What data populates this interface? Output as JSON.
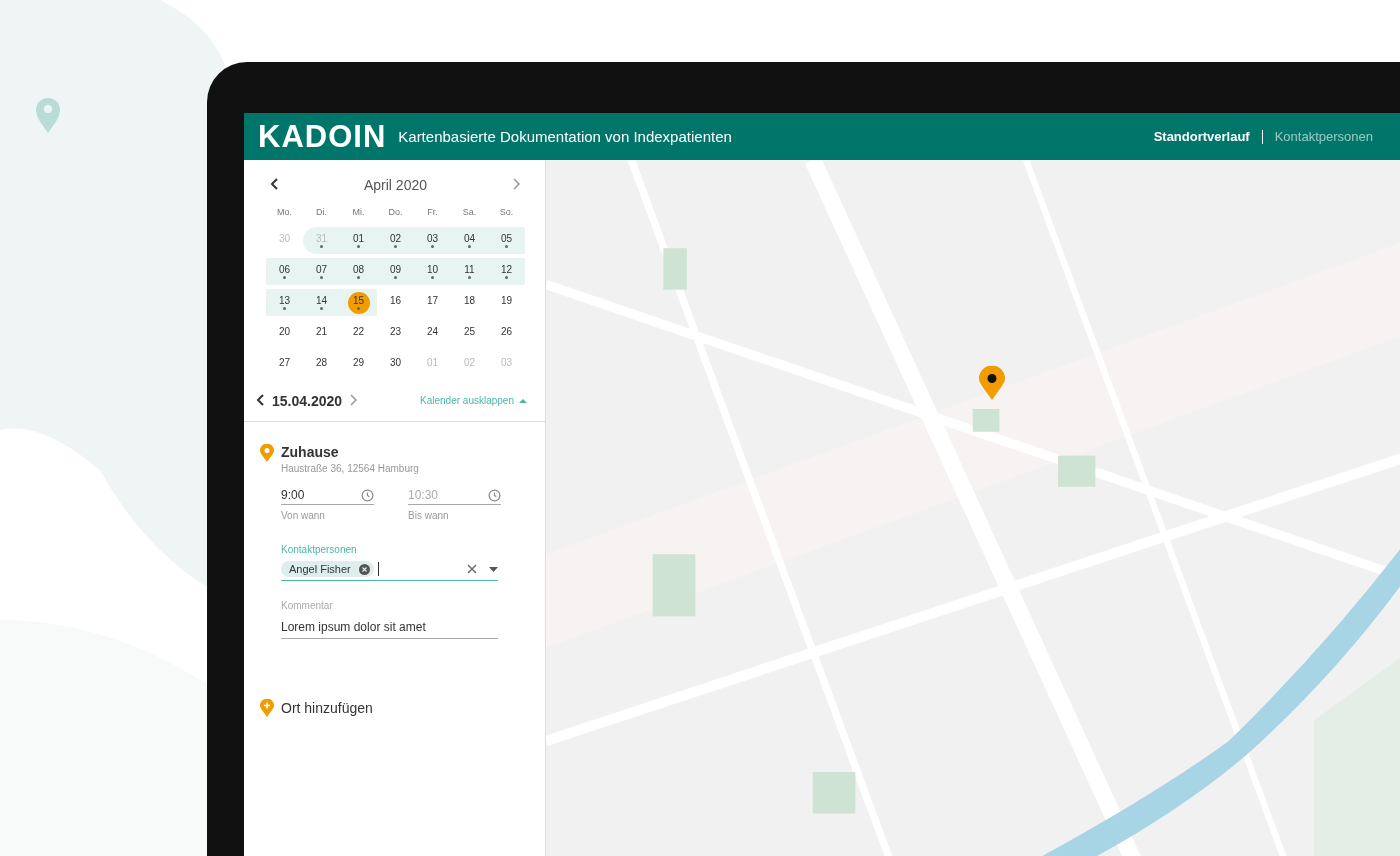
{
  "header": {
    "logo": "KADOIN",
    "subtitle": "Kartenbasierte Dokumentation von Indexpatienten",
    "nav": [
      {
        "label": "Standortverlauf",
        "selected": true
      },
      {
        "label": "Kontaktpersonen",
        "selected": false
      }
    ]
  },
  "calendar": {
    "month": "April 2020",
    "weekdays": [
      "Mo.",
      "Di.",
      "Mi.",
      "Do.",
      "Fr.",
      "Sa.",
      "So."
    ],
    "days": [
      {
        "label": "30",
        "outside": true,
        "dot": false,
        "band": false,
        "selected": false
      },
      {
        "label": "31",
        "outside": true,
        "dot": true,
        "band": true,
        "selected": false
      },
      {
        "label": "01",
        "outside": false,
        "dot": true,
        "band": true,
        "selected": false
      },
      {
        "label": "02",
        "outside": false,
        "dot": true,
        "band": true,
        "selected": false
      },
      {
        "label": "03",
        "outside": false,
        "dot": true,
        "band": true,
        "selected": false
      },
      {
        "label": "04",
        "outside": false,
        "dot": true,
        "band": true,
        "selected": false
      },
      {
        "label": "05",
        "outside": false,
        "dot": true,
        "band": true,
        "selected": false
      },
      {
        "label": "06",
        "outside": false,
        "dot": true,
        "band": true,
        "selected": false
      },
      {
        "label": "07",
        "outside": false,
        "dot": true,
        "band": true,
        "selected": false
      },
      {
        "label": "08",
        "outside": false,
        "dot": true,
        "band": true,
        "selected": false
      },
      {
        "label": "09",
        "outside": false,
        "dot": true,
        "band": true,
        "selected": false
      },
      {
        "label": "10",
        "outside": false,
        "dot": true,
        "band": true,
        "selected": false
      },
      {
        "label": "11",
        "outside": false,
        "dot": true,
        "band": true,
        "selected": false
      },
      {
        "label": "12",
        "outside": false,
        "dot": true,
        "band": true,
        "selected": false
      },
      {
        "label": "13",
        "outside": false,
        "dot": true,
        "band": true,
        "selected": false
      },
      {
        "label": "14",
        "outside": false,
        "dot": true,
        "band": true,
        "selected": false
      },
      {
        "label": "15",
        "outside": false,
        "dot": true,
        "band": true,
        "selected": true
      },
      {
        "label": "16",
        "outside": false,
        "dot": false,
        "band": false,
        "selected": false
      },
      {
        "label": "17",
        "outside": false,
        "dot": false,
        "band": false,
        "selected": false
      },
      {
        "label": "18",
        "outside": false,
        "dot": false,
        "band": false,
        "selected": false
      },
      {
        "label": "19",
        "outside": false,
        "dot": false,
        "band": false,
        "selected": false
      },
      {
        "label": "20",
        "outside": false,
        "dot": false,
        "band": false,
        "selected": false
      },
      {
        "label": "21",
        "outside": false,
        "dot": false,
        "band": false,
        "selected": false
      },
      {
        "label": "22",
        "outside": false,
        "dot": false,
        "band": false,
        "selected": false
      },
      {
        "label": "23",
        "outside": false,
        "dot": false,
        "band": false,
        "selected": false
      },
      {
        "label": "24",
        "outside": false,
        "dot": false,
        "band": false,
        "selected": false
      },
      {
        "label": "25",
        "outside": false,
        "dot": false,
        "band": false,
        "selected": false
      },
      {
        "label": "26",
        "outside": false,
        "dot": false,
        "band": false,
        "selected": false
      },
      {
        "label": "27",
        "outside": false,
        "dot": false,
        "band": false,
        "selected": false
      },
      {
        "label": "28",
        "outside": false,
        "dot": false,
        "band": false,
        "selected": false
      },
      {
        "label": "29",
        "outside": false,
        "dot": false,
        "band": false,
        "selected": false
      },
      {
        "label": "30",
        "outside": false,
        "dot": false,
        "band": false,
        "selected": false
      },
      {
        "label": "01",
        "outside": true,
        "dot": false,
        "band": false,
        "selected": false
      },
      {
        "label": "02",
        "outside": true,
        "dot": false,
        "band": false,
        "selected": false
      },
      {
        "label": "03",
        "outside": true,
        "dot": false,
        "band": false,
        "selected": false
      }
    ],
    "date": "15.04.2020",
    "toggle": "Kalender ausklappen"
  },
  "place": {
    "title": "Zuhause",
    "address": "Haustraße 36, 12564 Hamburg",
    "from": {
      "value": "9:00",
      "label": "Von wann"
    },
    "to": {
      "placeholder": "10:30",
      "label": "Bis wann"
    },
    "contacts": {
      "label": "Kontaktpersonen",
      "chips": [
        "Angel Fisher"
      ]
    },
    "comment": {
      "label": "Kommentar",
      "value": "Lorem ipsum dolor sit amet"
    }
  },
  "add_place": "Ort hinzufügen"
}
